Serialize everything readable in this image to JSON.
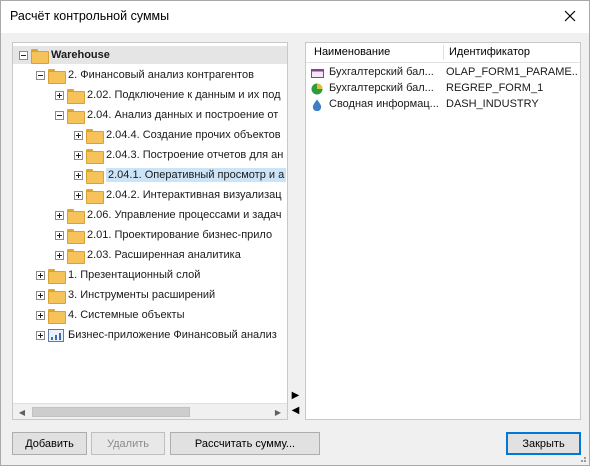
{
  "window": {
    "title": "Расчёт контрольной суммы",
    "close_glyph": "✕"
  },
  "tree": {
    "nodes": [
      {
        "label": "Warehouse",
        "level": 0,
        "toggle": "minus",
        "icon": "folder-icon",
        "bold": true
      },
      {
        "label": "2. Финансовый анализ контрагентов",
        "level": 1,
        "toggle": "minus",
        "icon": "folder-icon"
      },
      {
        "label": "2.02. Подключение к данным и их под",
        "level": 2,
        "toggle": "plus",
        "icon": "folder-icon"
      },
      {
        "label": "2.04. Анализ данных и построение от",
        "level": 2,
        "toggle": "minus",
        "icon": "folder-icon"
      },
      {
        "label": "2.04.4. Создание прочих объектов",
        "level": 3,
        "toggle": "plus",
        "icon": "folder-icon"
      },
      {
        "label": "2.04.3. Построение отчетов для ан",
        "level": 3,
        "toggle": "plus",
        "icon": "folder-icon"
      },
      {
        "label": "2.04.1. Оперативный просмотр и а",
        "level": 3,
        "toggle": "plus",
        "icon": "folder-icon",
        "selected": true
      },
      {
        "label": "2.04.2. Интерактивная визуализац",
        "level": 3,
        "toggle": "plus",
        "icon": "folder-icon"
      },
      {
        "label": "2.06. Управление процессами и задач",
        "level": 2,
        "toggle": "plus",
        "icon": "folder-icon"
      },
      {
        "label": "2.01. Проектирование бизнес-прило",
        "level": 2,
        "toggle": "plus",
        "icon": "folder-icon"
      },
      {
        "label": "2.03. Расширенная аналитика",
        "level": 2,
        "toggle": "plus",
        "icon": "folder-icon"
      },
      {
        "label": "1. Презентационный слой",
        "level": 1,
        "toggle": "plus",
        "icon": "folder-icon"
      },
      {
        "label": "3. Инструменты расширений",
        "level": 1,
        "toggle": "plus",
        "icon": "folder-icon"
      },
      {
        "label": "4. Системные объекты",
        "level": 1,
        "toggle": "plus",
        "icon": "folder-icon"
      },
      {
        "label": "Бизнес-приложение Финансовый анализ",
        "level": 1,
        "toggle": "plus",
        "icon": "business-app-icon"
      }
    ]
  },
  "grid": {
    "columns": [
      "Наименование",
      "Идентификатор"
    ],
    "rows": [
      {
        "name": "Бухгалтерский бал...",
        "id": "OLAP_FORM1_PARAME...",
        "icon": "olap-cube-icon"
      },
      {
        "name": "Бухгалтерский бал...",
        "id": "REGREP_FORM_1",
        "icon": "regular-report-icon"
      },
      {
        "name": "Сводная информац...",
        "id": "DASH_INDUSTRY",
        "icon": "dashboard-drop-icon"
      }
    ]
  },
  "buttons": {
    "add": "Добавить",
    "delete": "Удалить",
    "calculate": "Рассчитать сумму...",
    "close": "Закрыть"
  },
  "splitter": {
    "move_right_glyph": "▶",
    "move_left_glyph": "◀"
  },
  "colors": {
    "accent": "#0078d7",
    "selection": "#cce4f7",
    "folder": "#f5c35a"
  }
}
